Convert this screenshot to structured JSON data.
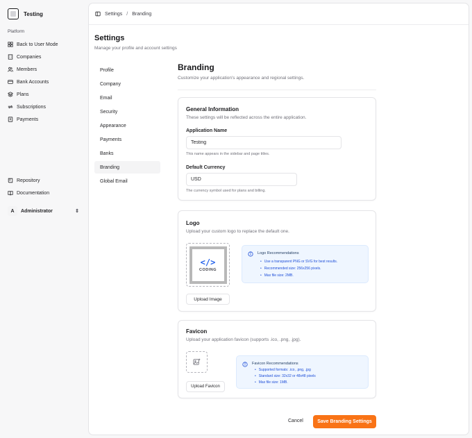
{
  "app": {
    "name": "Testing"
  },
  "sidebar": {
    "group_label": "Platform",
    "items": [
      {
        "label": "Back to User Mode",
        "icon": "grid-icon"
      },
      {
        "label": "Companies",
        "icon": "building-icon"
      },
      {
        "label": "Members",
        "icon": "users-icon"
      },
      {
        "label": "Bank Accounts",
        "icon": "credit-card-icon"
      },
      {
        "label": "Plans",
        "icon": "layers-icon"
      },
      {
        "label": "Subscriptions",
        "icon": "refresh-icon"
      },
      {
        "label": "Payments",
        "icon": "receipt-icon"
      }
    ],
    "bottom_items": [
      {
        "label": "Repository",
        "icon": "book-icon"
      },
      {
        "label": "Documentation",
        "icon": "book-open-icon"
      }
    ],
    "user": {
      "initial": "A",
      "name": "Administrator"
    }
  },
  "breadcrumb": {
    "parent": "Settings",
    "separator": "/",
    "current": "Branding"
  },
  "settings": {
    "title": "Settings",
    "subtitle": "Manage your profile and account settings",
    "tabs": [
      "Profile",
      "Company",
      "Email",
      "Security",
      "Appearance",
      "Payments",
      "Banks",
      "Branding",
      "Global Email"
    ],
    "active_tab": "Branding"
  },
  "branding": {
    "title": "Branding",
    "subtitle": "Customize your application's appearance and regional settings.",
    "general": {
      "title": "General Information",
      "description": "These settings will be reflected across the entire application.",
      "app_name_label": "Application Name",
      "app_name_value": "Testing",
      "app_name_hint": "This name appears in the sidebar and page titles.",
      "currency_label": "Default Currency",
      "currency_value": "USD",
      "currency_hint": "The currency symbol used for plans and billing."
    },
    "logo": {
      "title": "Logo",
      "description": "Upload your custom logo to replace the default one.",
      "preview_mark": "</>",
      "preview_word": "CODING",
      "upload_label": "Upload Image",
      "rec_title": "Logo Recommendations",
      "recommendations": [
        "Use a transparent PNG or SVG for best results.",
        "Recommended size: 256x256 pixels.",
        "Max file size: 2MB."
      ]
    },
    "favicon": {
      "title": "Favicon",
      "description": "Upload your application favicon (supports .ico, .png, .jpg).",
      "upload_label": "Upload Favicon",
      "rec_title": "Favicon Recommendations",
      "recommendations": [
        "Supported formats: .ico, .png, .jpg",
        "Standard size: 32x32 or 48x48 pixels",
        "Max file size: 1MB."
      ]
    },
    "actions": {
      "cancel": "Cancel",
      "save": "Save Branding Settings"
    }
  },
  "colors": {
    "accent": "#f97316",
    "info_bg": "#eff6ff",
    "info_text": "#1d4ed8"
  }
}
